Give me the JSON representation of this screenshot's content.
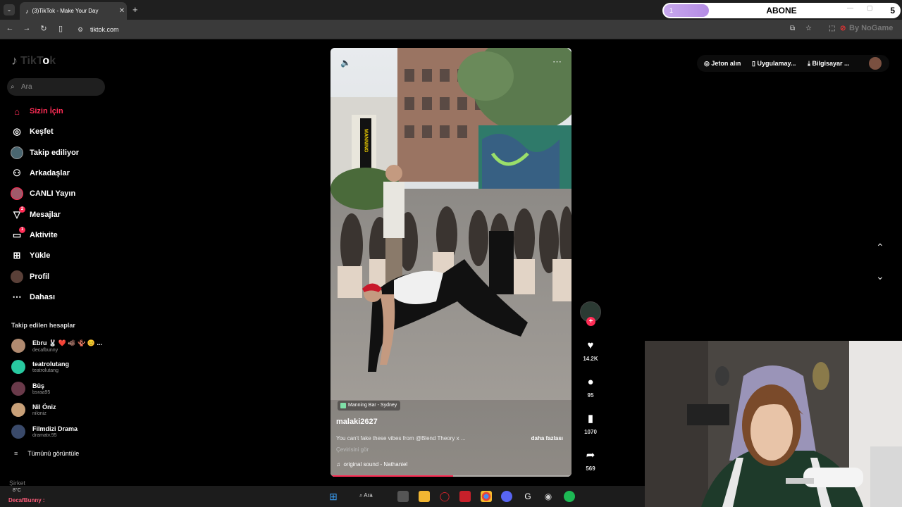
{
  "browser": {
    "tab_title": "(3)TikTok - Make Your Day",
    "tab_close": "✕",
    "new_tab": "+",
    "url": "tiktok.com",
    "tab_search_icon": "⌄"
  },
  "overlay": {
    "level": "1",
    "label": "ABONE",
    "count": "5",
    "extension_text": "By NoGame"
  },
  "sidebar": {
    "logo_text": "TikTok",
    "search_placeholder": "Ara",
    "nav": [
      {
        "label": "Sizin İçin",
        "icon": "home-icon"
      },
      {
        "label": "Keşfet",
        "icon": "compass-icon"
      },
      {
        "label": "Takip ediliyor",
        "icon": "following-avatar-icon"
      },
      {
        "label": "Arkadaşlar",
        "icon": "friends-icon"
      },
      {
        "label": "CANLI Yayın",
        "icon": "live-icon"
      },
      {
        "label": "Mesajlar",
        "icon": "send-icon",
        "badge": "2"
      },
      {
        "label": "Aktivite",
        "icon": "activity-icon",
        "badge": "1"
      },
      {
        "label": "Yükle",
        "icon": "upload-icon"
      },
      {
        "label": "Profil",
        "icon": "profile-avatar-icon"
      },
      {
        "label": "Dahası",
        "icon": "more-icon"
      }
    ],
    "following_title": "Takip edilen hesaplar",
    "accounts": [
      {
        "name": "Ebru 🐰 ❤️ 🐗 🪸 😊 ...",
        "handle": "decafbunny"
      },
      {
        "name": "teatrolutang",
        "handle": "teatrolutang"
      },
      {
        "name": "Büş",
        "handle": "bsraa95"
      },
      {
        "name": "Nil Öniz",
        "handle": "niloniz"
      },
      {
        "name": "Filmdizi Drama",
        "handle": "dramatv.95"
      }
    ],
    "see_all": "Tümünü görüntüle",
    "company": "Şirket"
  },
  "video": {
    "location": "Manning Bar - Sydney",
    "author": "malaki2627",
    "caption": "You can't fake these vibes from @Blend Theory x ...",
    "more": "daha fazlası",
    "translate": "Çevirisini gör",
    "sound": "original sound - Nathaniel",
    "progress": 0.51,
    "building_text": "MANNING"
  },
  "actions": {
    "likes": "14.2K",
    "comments": "95",
    "saves": "1070",
    "shares": "569"
  },
  "topright": {
    "coins": "Jeton alın",
    "app": "Uygulamay...",
    "pc": "Bilgisayar ..."
  },
  "taskbar": {
    "weather_temp": "8°C",
    "stream_tag": "DecafBunny :",
    "search_label": "Ara"
  },
  "colors": {
    "accent": "#fe2c55",
    "abone_pill": "#b48ce4"
  }
}
